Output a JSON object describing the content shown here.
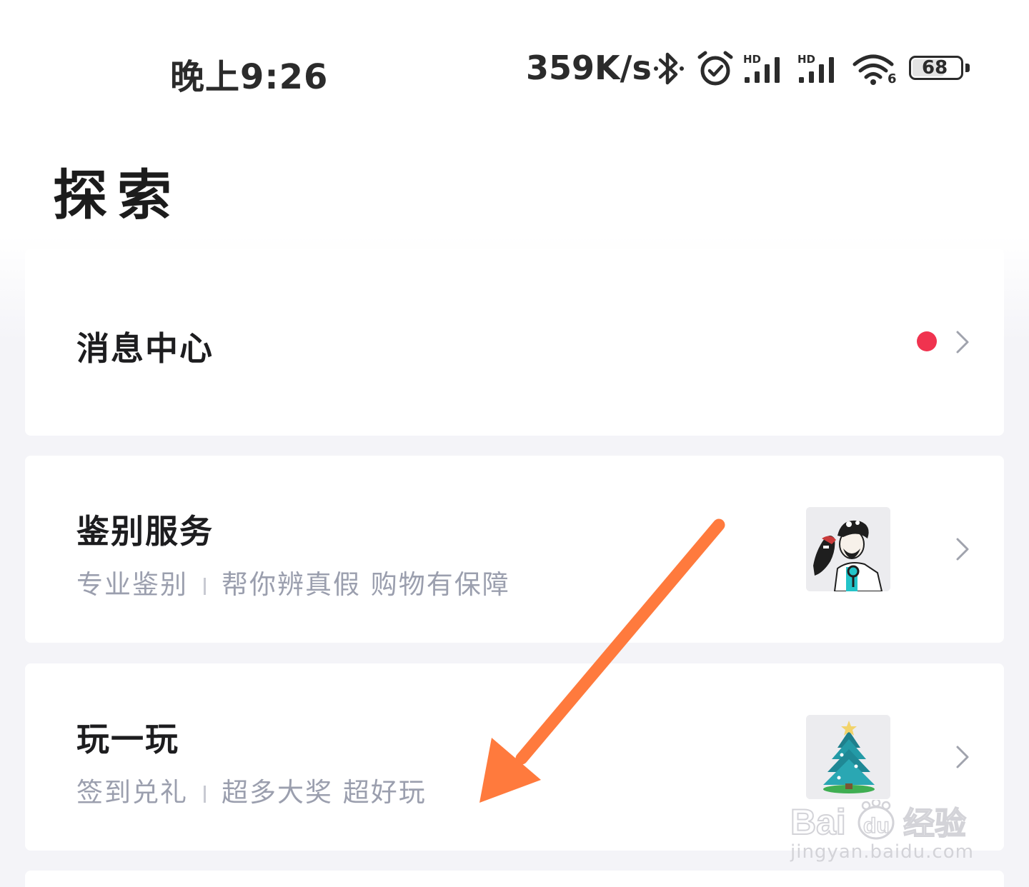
{
  "status_bar": {
    "time": "晚上9:26",
    "network_speed": "359K/s",
    "battery": "68",
    "sim1_label": "HD",
    "sim2_label": "HD",
    "wifi_label": "6",
    "icons": [
      "bluetooth-icon",
      "alarm-icon",
      "signal-icon",
      "signal-icon",
      "wifi-icon",
      "battery-icon"
    ]
  },
  "page": {
    "title": "探索"
  },
  "cards": [
    {
      "title": "消息中心",
      "has_badge": true,
      "badge_color": "#f0334f"
    },
    {
      "title": "鉴别服务",
      "subtitle_left": "专业鉴别",
      "subtitle_right": "帮你辨真假 购物有保障",
      "thumbnail": "appraiser-illustration"
    },
    {
      "title": "玩一玩",
      "subtitle_left": "签到兑礼",
      "subtitle_right": "超多大奖 超好玩",
      "thumbnail": "christmas-tree-illustration"
    }
  ],
  "annotation": {
    "arrow_color": "#ff7a3d"
  },
  "watermark": {
    "brand_latin": "Bai",
    "brand_mid": "du",
    "brand_cn": "经验",
    "url": "jingyan.baidu.com"
  },
  "colors": {
    "accent_red": "#f0334f",
    "subtitle_gray": "#9b9fae",
    "background": "#f4f4f8"
  }
}
